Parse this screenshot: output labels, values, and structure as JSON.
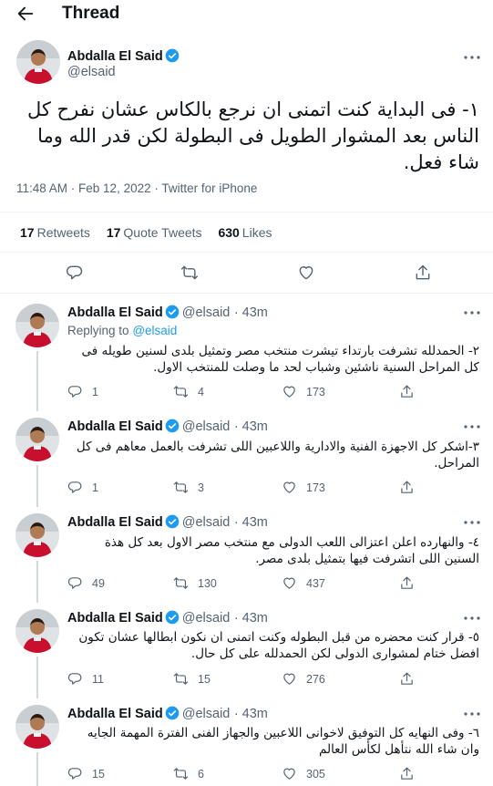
{
  "header": {
    "title": "Thread"
  },
  "main_tweet": {
    "author_name": "Abdalla El Said",
    "handle": "@elsaid",
    "text": "١- فى البداية كنت اتمنى ان نرجع بالكاس عشان نفرح كل الناس بعد المشوار الطويل فى البطولة لكن قدر الله وما شاء فعل.",
    "timestamp": "11:48 AM · Feb 12, 2022",
    "source": "Twitter for iPhone",
    "stats": [
      {
        "count": "17",
        "label": "Retweets"
      },
      {
        "count": "17",
        "label": "Quote Tweets"
      },
      {
        "count": "630",
        "label": "Likes"
      }
    ]
  },
  "replies": [
    {
      "author_name": "Abdalla El Said",
      "handle": "@elsaid",
      "time": "· 43m",
      "replying_label": "Replying to",
      "replying_to": "@elsaid",
      "text": "٢- الحمدلله تشرفت بارتداء تيشرت منتخب مصر وتمثيل بلدى لسنين طويله فى كل المراحل السنية ناشئين وشباب لحد ما وصلت للمنتخب الاول.",
      "replies": "1",
      "retweets": "4",
      "likes": "173"
    },
    {
      "author_name": "Abdalla El Said",
      "handle": "@elsaid",
      "time": "· 43m",
      "text": "٣-اشكر كل الاجهزة الفنية والادارية واللاعبين اللى تشرفت بالعمل معاهم فى كل المراحل.",
      "replies": "1",
      "retweets": "3",
      "likes": "173"
    },
    {
      "author_name": "Abdalla El Said",
      "handle": "@elsaid",
      "time": "· 43m",
      "text": "٤- والنهارده اعلن اعتزالى اللعب الدولى مع منتخب مصر الاول بعد كل هذة السنين اللى اتشرفت فيها بتمثيل بلدى مصر.",
      "replies": "49",
      "retweets": "130",
      "likes": "437"
    },
    {
      "author_name": "Abdalla El Said",
      "handle": "@elsaid",
      "time": "· 43m",
      "text": "٥- قرار كنت محضره من قبل البطوله وكنت اتمنى ان نكون ابطالها عشان تكون افضل ختام لمشوارى الدولى لكن الحمدلله على كل حال.",
      "replies": "11",
      "retweets": "15",
      "likes": "276"
    },
    {
      "author_name": "Abdalla El Said",
      "handle": "@elsaid",
      "time": "· 43m",
      "text": "٦- وفى النهايه كل التوفيق لاخوانى اللاعبين والجهاز الفنى الفترة المهمة الجايه وان شاء الله نتأهل لكأس العالم",
      "replies": "15",
      "retweets": "6",
      "likes": "305"
    }
  ],
  "colors": {
    "accent": "#1d9bf0",
    "muted": "#536471",
    "jersey": "#c8102e"
  },
  "icons": [
    "back-arrow-icon",
    "verified-badge-icon",
    "more-icon",
    "reply-icon",
    "retweet-icon",
    "like-icon",
    "share-icon"
  ]
}
